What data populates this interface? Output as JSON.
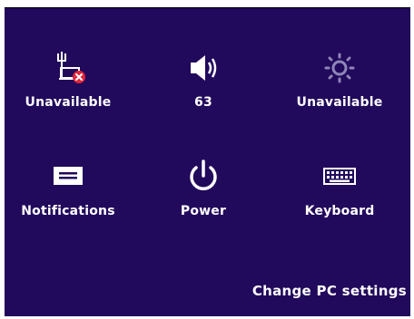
{
  "settings_panel": {
    "tiles": [
      {
        "label": "Unavailable",
        "icon": "network-unavailable-icon"
      },
      {
        "label": "63",
        "icon": "speaker-icon"
      },
      {
        "label": "Unavailable",
        "icon": "brightness-icon"
      },
      {
        "label": "Notifications",
        "icon": "notifications-icon"
      },
      {
        "label": "Power",
        "icon": "power-icon"
      },
      {
        "label": "Keyboard",
        "icon": "keyboard-icon"
      }
    ],
    "change_pc_settings": "Change PC settings"
  },
  "colors": {
    "panel_background": "#21095c",
    "foreground": "#ffffff",
    "error_badge": "#e0263a"
  }
}
